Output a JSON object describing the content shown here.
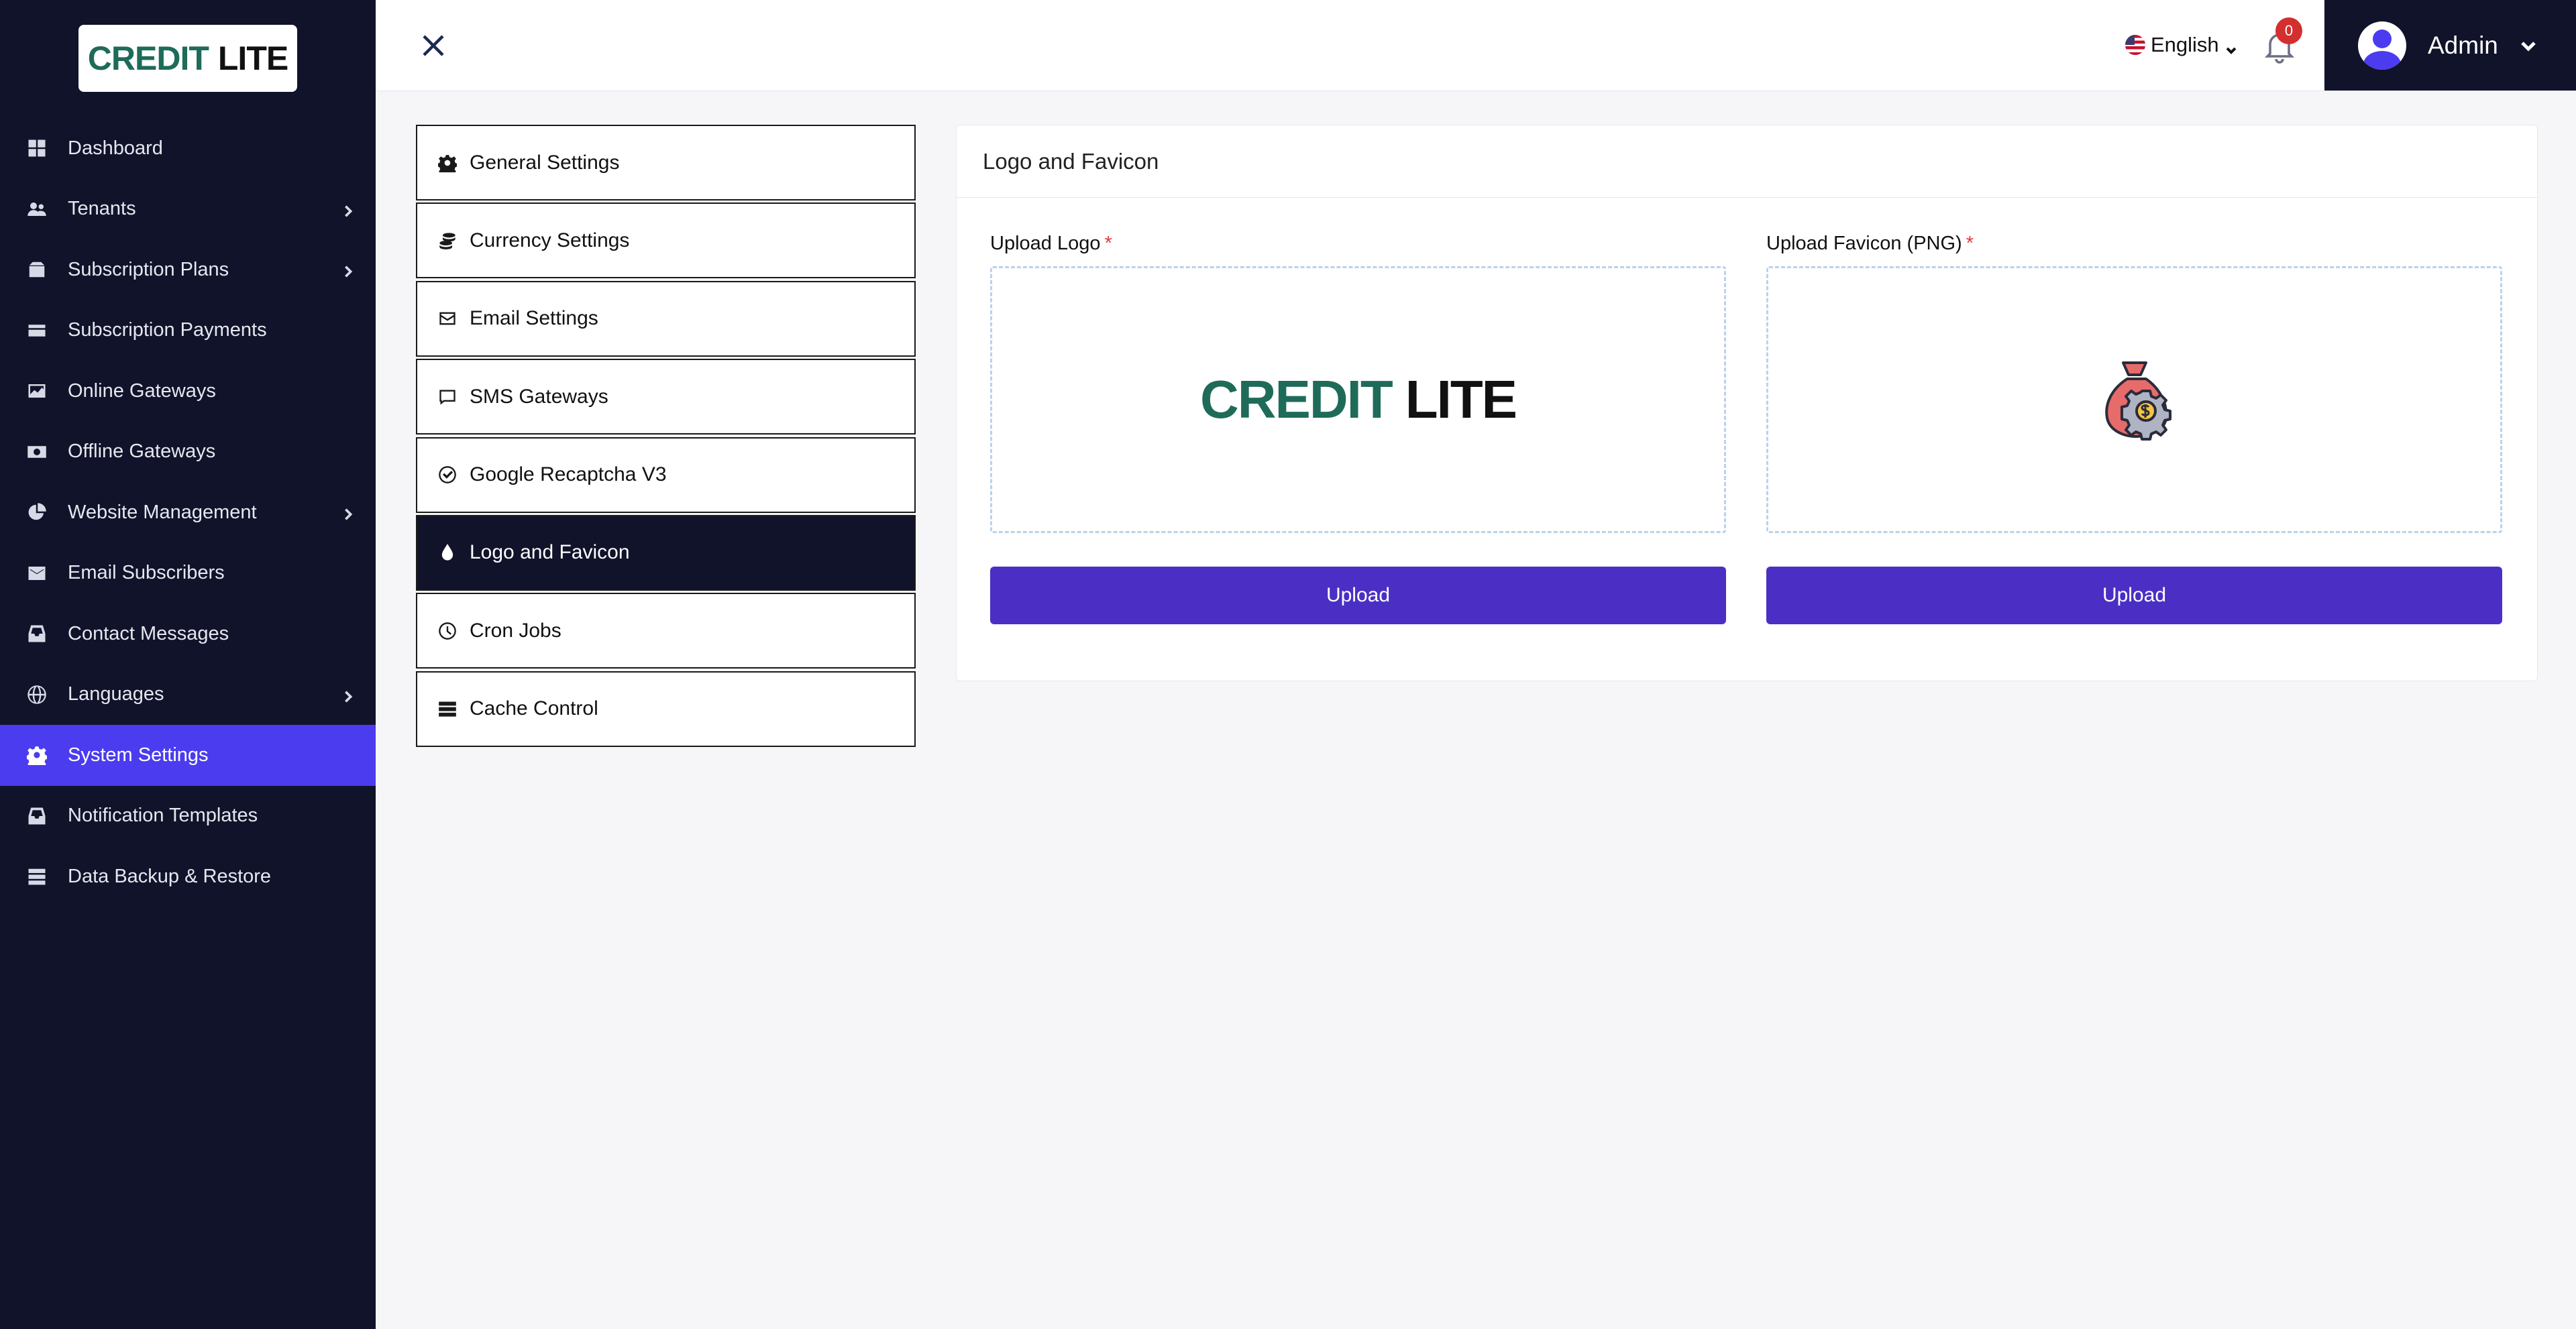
{
  "brand": {
    "part1": "CREDIT",
    "part2": "LITE"
  },
  "sidebar": {
    "items": [
      {
        "label": "Dashboard",
        "icon": "dashboard-icon",
        "has_submenu": false
      },
      {
        "label": "Tenants",
        "icon": "users-icon",
        "has_submenu": true
      },
      {
        "label": "Subscription Plans",
        "icon": "box-icon",
        "has_submenu": true
      },
      {
        "label": "Subscription Payments",
        "icon": "credit-card-icon",
        "has_submenu": false
      },
      {
        "label": "Online Gateways",
        "icon": "online-gateway-icon",
        "has_submenu": false
      },
      {
        "label": "Offline Gateways",
        "icon": "money-bill-icon",
        "has_submenu": false
      },
      {
        "label": "Website Management",
        "icon": "chart-pie-icon",
        "has_submenu": true
      },
      {
        "label": "Email Subscribers",
        "icon": "envelope-icon",
        "has_submenu": false
      },
      {
        "label": "Contact Messages",
        "icon": "inbox-icon",
        "has_submenu": false
      },
      {
        "label": "Languages",
        "icon": "globe-icon",
        "has_submenu": true
      },
      {
        "label": "System Settings",
        "icon": "gear-icon",
        "has_submenu": false,
        "active": true
      },
      {
        "label": "Notification Templates",
        "icon": "inbox-icon",
        "has_submenu": false
      },
      {
        "label": "Data Backup & Restore",
        "icon": "database-icon",
        "has_submenu": false
      }
    ]
  },
  "topbar": {
    "language": "English",
    "notification_count": "0",
    "user_name": "Admin"
  },
  "settings_menu": [
    {
      "label": "General Settings",
      "icon": "gear-icon"
    },
    {
      "label": "Currency Settings",
      "icon": "coins-icon"
    },
    {
      "label": "Email Settings",
      "icon": "envelope-icon"
    },
    {
      "label": "SMS Gateways",
      "icon": "comment-icon"
    },
    {
      "label": "Google Recaptcha V3",
      "icon": "check-circle-icon"
    },
    {
      "label": "Logo and Favicon",
      "icon": "droplet-icon",
      "active": true
    },
    {
      "label": "Cron Jobs",
      "icon": "clock-icon"
    },
    {
      "label": "Cache Control",
      "icon": "server-icon"
    }
  ],
  "card": {
    "title": "Logo and Favicon",
    "logo": {
      "label": "Upload Logo",
      "required_mark": "*",
      "button": "Upload",
      "preview_part1": "CREDIT",
      "preview_part2": "LITE"
    },
    "favicon": {
      "label": "Upload Favicon (PNG)",
      "required_mark": "*",
      "button": "Upload"
    }
  },
  "colors": {
    "sidebar_bg": "#11132a",
    "active_nav": "#4b3cf0",
    "button": "#4b2fc5",
    "brand_green": "#1f6b5a",
    "badge": "#d32f2f"
  }
}
